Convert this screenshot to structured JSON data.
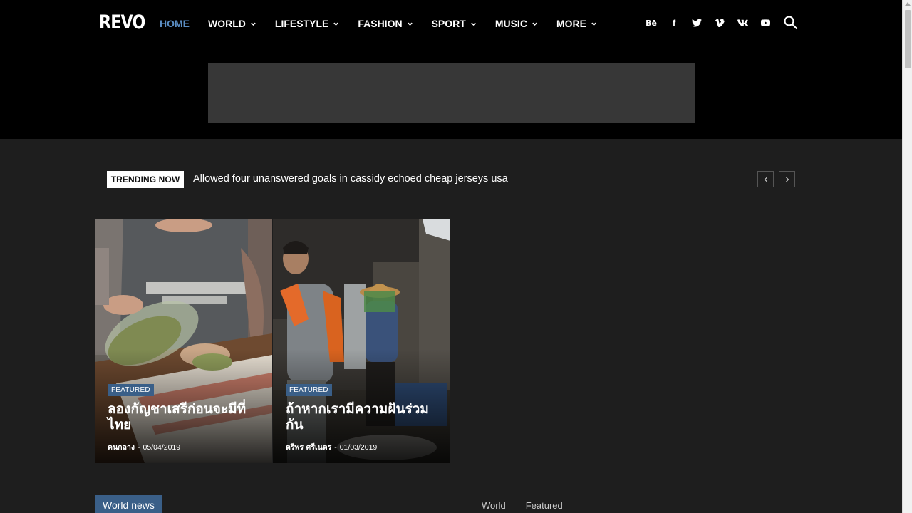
{
  "header": {
    "logo": "REVO",
    "nav": [
      {
        "label": "HOME",
        "active": true,
        "dropdown": false
      },
      {
        "label": "WORLD",
        "active": false,
        "dropdown": true
      },
      {
        "label": "LIFESTYLE",
        "active": false,
        "dropdown": true
      },
      {
        "label": "FASHION",
        "active": false,
        "dropdown": true
      },
      {
        "label": "SPORT",
        "active": false,
        "dropdown": true
      },
      {
        "label": "MUSIC",
        "active": false,
        "dropdown": true
      },
      {
        "label": "MORE",
        "active": false,
        "dropdown": true
      }
    ],
    "social": [
      {
        "icon": "behance-icon",
        "glyph": "Bē"
      },
      {
        "icon": "facebook-icon",
        "glyph": "f"
      },
      {
        "icon": "twitter-icon",
        "glyph": ""
      },
      {
        "icon": "vimeo-icon",
        "glyph": "v"
      },
      {
        "icon": "vk-icon",
        "glyph": "vk"
      },
      {
        "icon": "youtube-icon",
        "glyph": ""
      }
    ],
    "active_color": "#5b8ec4"
  },
  "trending": {
    "label": "TRENDING NOW",
    "headline": "Allowed four unanswered goals in cassidy echoed cheap jerseys usa"
  },
  "featured": [
    {
      "badge": "FEATURED",
      "title": "ลองกัญชาเสรีก่อนจะมีที่ไทย",
      "author": "คนกลาง",
      "date": "05/04/2019"
    },
    {
      "badge": "FEATURED",
      "title": "ถ้าหากเรามีความฝันร่วมกัน",
      "author": "ตรีพร ศรีเนตร",
      "date": "01/03/2019"
    }
  ],
  "section": {
    "title": "World news",
    "tabs": [
      "World",
      "Featured"
    ]
  },
  "colors": {
    "badge": "#3a5f88",
    "background": "#1e1e1e",
    "header": "#000000"
  }
}
